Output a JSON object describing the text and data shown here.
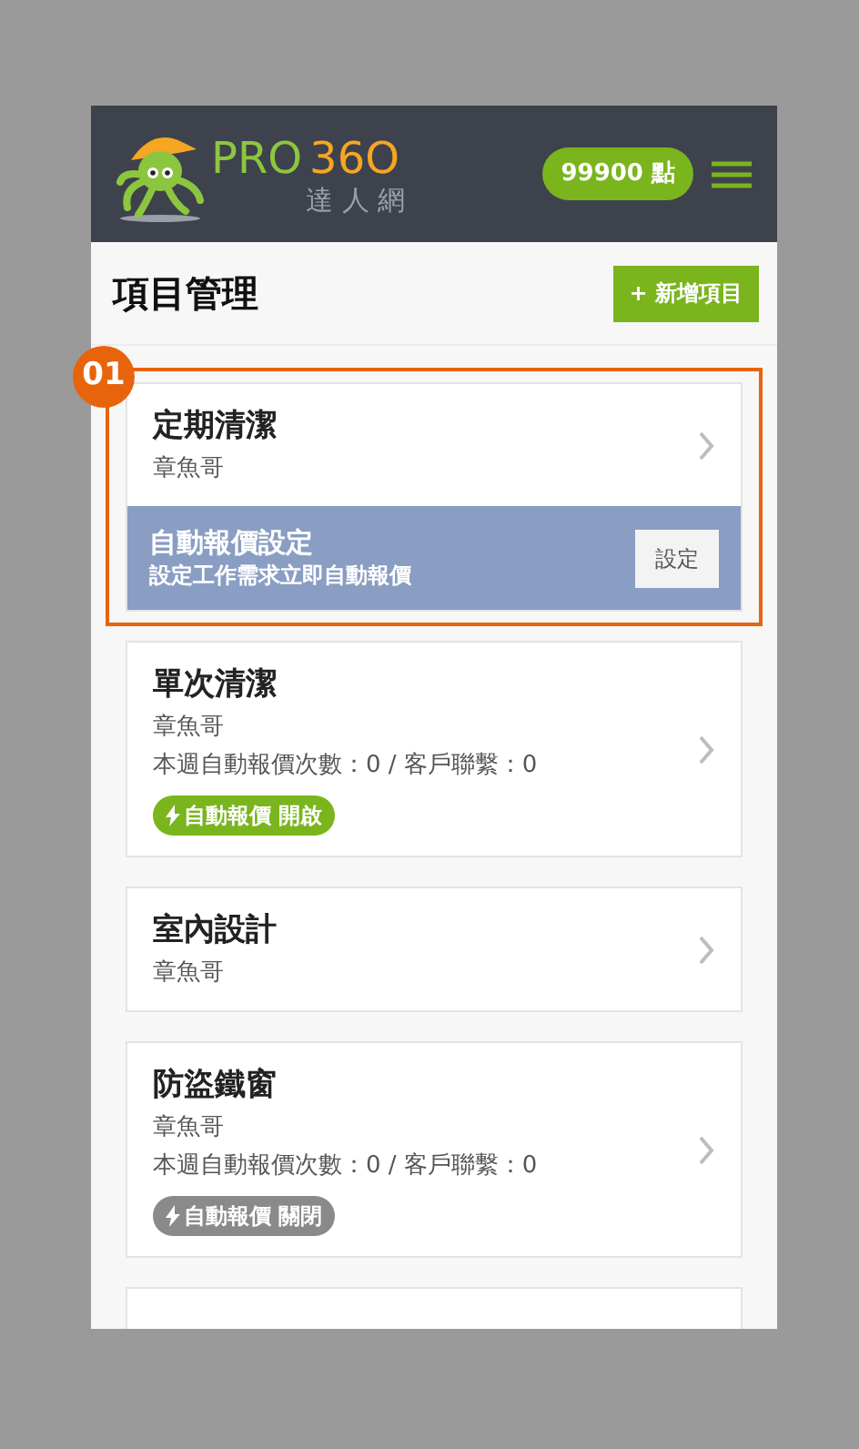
{
  "header": {
    "logo": {
      "brand": "PRO",
      "number": "36O",
      "subtitle": "達 人 網"
    },
    "points": "99900 點"
  },
  "page": {
    "title": "項目管理",
    "add_button": "+ 新增項目"
  },
  "projects": [
    {
      "title": "定期清潔",
      "owner": "章魚哥",
      "annotation": "01",
      "banner": {
        "title": "自動報價設定",
        "subtitle": "設定工作需求立即自動報價",
        "button": "設定"
      }
    },
    {
      "title": "單次清潔",
      "owner": "章魚哥",
      "stats": "本週自動報價次數：0 / 客戶聯繫：0",
      "auto_quote": {
        "label": "自動報價 開啟",
        "on": true
      }
    },
    {
      "title": "室內設計",
      "owner": "章魚哥"
    },
    {
      "title": "防盜鐵窗",
      "owner": "章魚哥",
      "stats": "本週自動報價次數：0 / 客戶聯繫：0",
      "auto_quote": {
        "label": "自動報價 關閉",
        "on": false
      }
    }
  ]
}
